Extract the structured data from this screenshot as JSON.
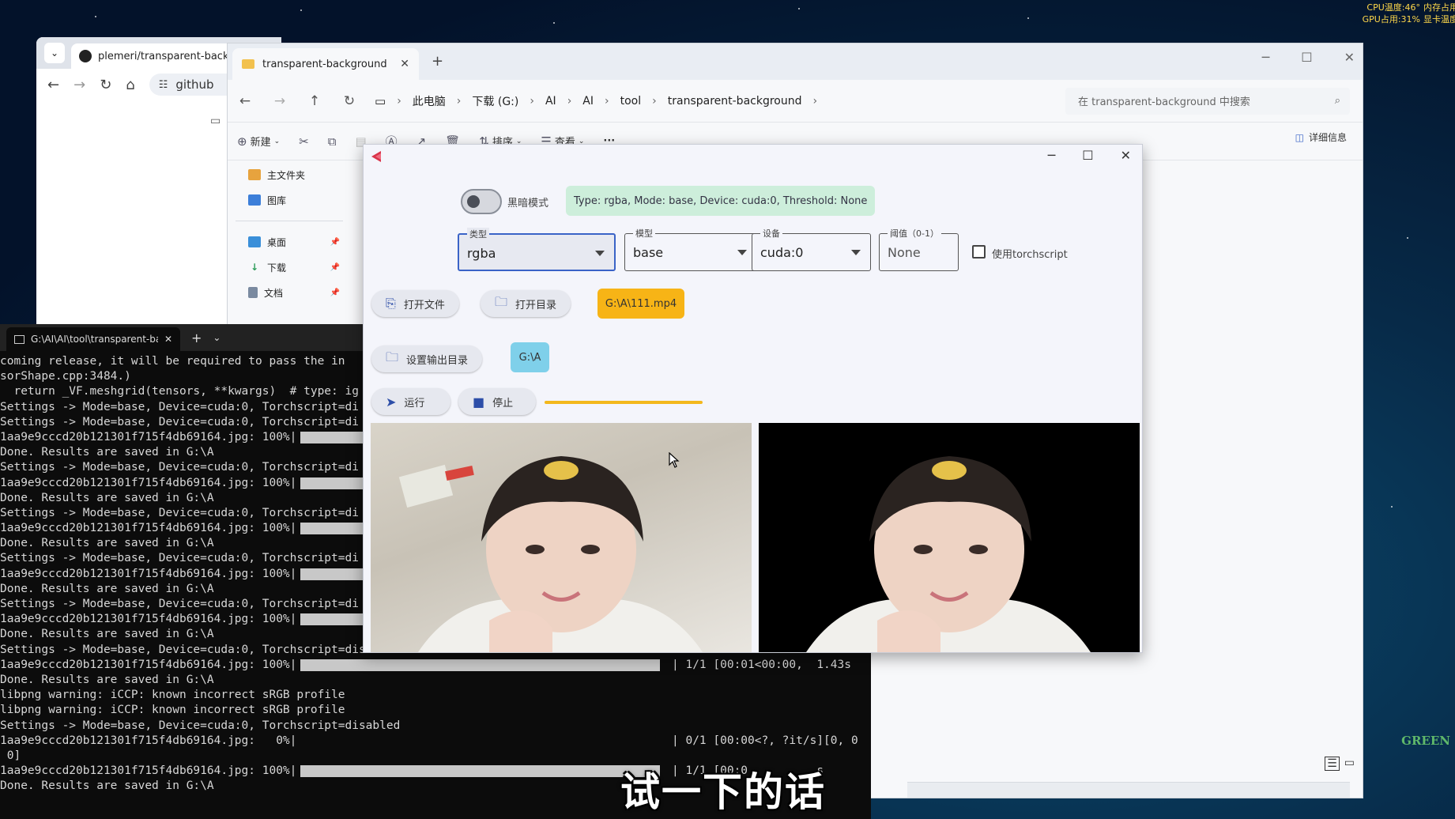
{
  "system_overlay": {
    "cpu_temp": "CPU温度:46°",
    "gpu_usage": "GPU占用:31%",
    "mem_usage": "内存占用",
    "gpu_temp": "显卡温度"
  },
  "browser": {
    "tab_title": "plemeri/transparent-backgro",
    "url_text": "github"
  },
  "explorer": {
    "tab_title": "transparent-background",
    "new_tab": "+",
    "breadcrumbs": [
      "此电脑",
      "下载 (G:)",
      "AI",
      "AI",
      "tool",
      "transparent-background"
    ],
    "search_placeholder": "在 transparent-background 中搜索",
    "toolbar": {
      "new": "新建",
      "sort": "排序",
      "view": "查看",
      "more": "···",
      "details": "详细信息"
    },
    "sidebar": [
      {
        "label": "主文件夹",
        "color": "#e7a33e",
        "pinned": false
      },
      {
        "label": "图库",
        "color": "#3c7fd9",
        "pinned": false
      },
      {
        "label": "桌面",
        "color": "#3a8fd9",
        "pinned": true
      },
      {
        "label": "下载",
        "color": "#2e9d5a",
        "pinned": true
      },
      {
        "label": "文档",
        "color": "#7a8aa0",
        "pinned": true
      }
    ]
  },
  "terminal": {
    "tab_title": "G:\\AI\\AI\\tool\\transparent-bac",
    "new_tab": "+",
    "lines": [
      "coming release, it will be required to pass the in",
      "sorShape.cpp:3484.)",
      "  return _VF.meshgrid(tensors, **kwargs)  # type: ig",
      "Settings -> Mode=base, Device=cuda:0, Torchscript=di",
      "Settings -> Mode=base, Device=cuda:0, Torchscript=di",
      "1aa9e9cccd20b121301f715f4db69164.jpg: 100%|",
      "Done. Results are saved in G:\\A",
      "Settings -> Mode=base, Device=cuda:0, Torchscript=di",
      "1aa9e9cccd20b121301f715f4db69164.jpg: 100%|",
      "Done. Results are saved in G:\\A",
      "Settings -> Mode=base, Device=cuda:0, Torchscript=di",
      "1aa9e9cccd20b121301f715f4db69164.jpg: 100%|",
      "Done. Results are saved in G:\\A",
      "Settings -> Mode=base, Device=cuda:0, Torchscript=di",
      "1aa9e9cccd20b121301f715f4db69164.jpg: 100%|",
      "Done. Results are saved in G:\\A",
      "Settings -> Mode=base, Device=cuda:0, Torchscript=di",
      "1aa9e9cccd20b121301f715f4db69164.jpg: 100%|",
      "Done. Results are saved in G:\\A",
      "Settings -> Mode=base, Device=cuda:0, Torchscript=disabled",
      "1aa9e9cccd20b121301f715f4db69164.jpg: 100%|",
      "Done. Results are saved in G:\\A",
      "libpng warning: iCCP: known incorrect sRGB profile",
      "libpng warning: iCCP: known incorrect sRGB profile",
      "Settings -> Mode=base, Device=cuda:0, Torchscript=disabled",
      "1aa9e9cccd20b121301f715f4db69164.jpg:   0%|",
      " 0]",
      "1aa9e9cccd20b121301f715f4db69164.jpg: 100%|",
      "Done. Results are saved in G:\\A"
    ],
    "bar_rows": [
      5,
      8,
      11,
      14,
      17,
      20,
      27
    ],
    "right_texts": [
      {
        "row": 20,
        "text": "| 1/1 [00:01<00:00,  1.43s"
      },
      {
        "row": 25,
        "text": "| 0/1 [00:00<?, ?it/s][0, 0"
      },
      {
        "row": 27,
        "text": "| 1/1 [00:0          s"
      }
    ]
  },
  "app": {
    "dark_mode_label": "黑暗模式",
    "status": "Type: rgba, Mode: base, Device: cuda:0, Threshold: None",
    "fields": [
      {
        "label": "类型",
        "value": "rgba"
      },
      {
        "label": "模型",
        "value": "base"
      },
      {
        "label": "设备",
        "value": "cuda:0"
      },
      {
        "label": "阈值（0-1）",
        "value": "None"
      }
    ],
    "torchscript_label": "使用torchscript",
    "open_file": "打开文件",
    "open_dir": "打开目录",
    "input_path": "G:\\A\\111.mp4",
    "set_output": "设置输出目录",
    "output_path": "G:\\A",
    "run": "运行",
    "stop": "停止",
    "progress": 1.0
  },
  "subtitle": "试一下的话",
  "watermark": "GREEN",
  "colors": {
    "accent_blue": "#3a63c7",
    "status_green": "#cdeedb",
    "input_chip": "#f7b416",
    "output_chip": "#7fd0ea",
    "progress": "#f3b81d"
  }
}
